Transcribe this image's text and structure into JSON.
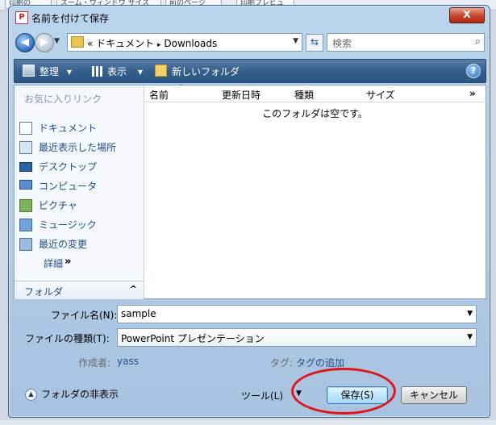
{
  "background": {
    "tabs": [
      "印刷の",
      "ズーム・ウィンドウ サイズ",
      "前のページ",
      "印刷プレビュ"
    ]
  },
  "window": {
    "title": "名前を付けて保存",
    "close_label": "X"
  },
  "address": {
    "path_prefix": "«",
    "path_part1": "ドキュメント",
    "path_sep": "▸",
    "path_part2": "Downloads",
    "search_placeholder": "検索"
  },
  "toolbar": {
    "organize": "整理",
    "view": "表示",
    "new_folder": "新しいフォルダ",
    "dropdown_glyph": "▾"
  },
  "nav_pane": {
    "favorites_header": "お気に入りリンク",
    "items": [
      {
        "label": "ドキュメント",
        "icon": "documents-icon"
      },
      {
        "label": "最近表示した場所",
        "icon": "recent-places-icon"
      },
      {
        "label": "デスクトップ",
        "icon": "desktop-icon"
      },
      {
        "label": "コンピュータ",
        "icon": "computer-icon"
      },
      {
        "label": "ピクチャ",
        "icon": "pictures-icon"
      },
      {
        "label": "ミュージック",
        "icon": "music-icon"
      },
      {
        "label": "最近の変更",
        "icon": "recent-changes-icon"
      }
    ],
    "more_label": "詳細",
    "more_arrow": "»",
    "folders_label": "フォルダ",
    "folders_caret": "^"
  },
  "file_list": {
    "columns": [
      "名前",
      "更新日時",
      "種類",
      "サイズ"
    ],
    "overflow_glyph": "»",
    "empty_message": "このフォルダは空です。"
  },
  "form": {
    "filename_label": "ファイル名(N):",
    "filename_value": "sample",
    "filetype_label": "ファイルの種類(T):",
    "filetype_value": "PowerPoint プレゼンテーション",
    "author_label": "作成者:",
    "author_value": "yass",
    "tags_label": "タグ:",
    "tags_value": "タグの追加"
  },
  "bottom": {
    "hide_folders_label": "フォルダの非表示",
    "tools_label": "ツール(L)",
    "save_label": "保存(S)",
    "cancel_label": "キャンセル"
  },
  "colors": {
    "annotation": "#e0141b",
    "toolbar_bg": "#355f8c",
    "link_blue": "#1f4f86"
  }
}
